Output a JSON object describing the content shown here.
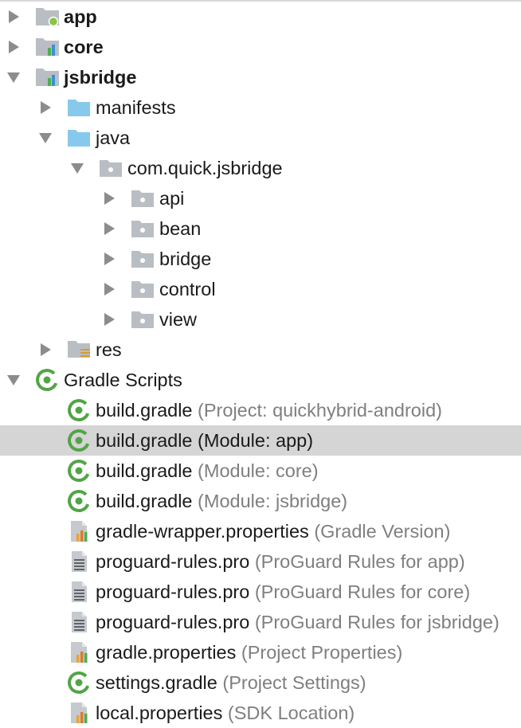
{
  "tree": {
    "items": [
      {
        "label": "app",
        "detail": ""
      },
      {
        "label": "core",
        "detail": ""
      },
      {
        "label": "jsbridge",
        "detail": ""
      },
      {
        "label": "manifests",
        "detail": ""
      },
      {
        "label": "java",
        "detail": ""
      },
      {
        "label": "com.quick.jsbridge",
        "detail": ""
      },
      {
        "label": "api",
        "detail": ""
      },
      {
        "label": "bean",
        "detail": ""
      },
      {
        "label": "bridge",
        "detail": ""
      },
      {
        "label": "control",
        "detail": ""
      },
      {
        "label": "view",
        "detail": ""
      },
      {
        "label": "res",
        "detail": ""
      },
      {
        "label": "Gradle Scripts",
        "detail": ""
      },
      {
        "label": "build.gradle",
        "detail": "(Project: quickhybrid-android)"
      },
      {
        "label": "build.gradle",
        "detail": "(Module: app)"
      },
      {
        "label": "build.gradle",
        "detail": "(Module: core)"
      },
      {
        "label": "build.gradle",
        "detail": "(Module: jsbridge)"
      },
      {
        "label": "gradle-wrapper.properties",
        "detail": "(Gradle Version)"
      },
      {
        "label": "proguard-rules.pro",
        "detail": "(ProGuard Rules for app)"
      },
      {
        "label": "proguard-rules.pro",
        "detail": "(ProGuard Rules for core)"
      },
      {
        "label": "proguard-rules.pro",
        "detail": "(ProGuard Rules for jsbridge)"
      },
      {
        "label": "gradle.properties",
        "detail": "(Project Properties)"
      },
      {
        "label": "settings.gradle",
        "detail": "(Project Settings)"
      },
      {
        "label": "local.properties",
        "detail": "(SDK Location)"
      }
    ],
    "selected_index": 14
  },
  "colors": {
    "selection": "#d5d5d5",
    "folder_blue": "#87c9ec",
    "folder_grey": "#b9bec4",
    "gradle_green": "#52a447",
    "module_dot": "#8bc34a",
    "secondary_text": "#7f7f7f"
  }
}
